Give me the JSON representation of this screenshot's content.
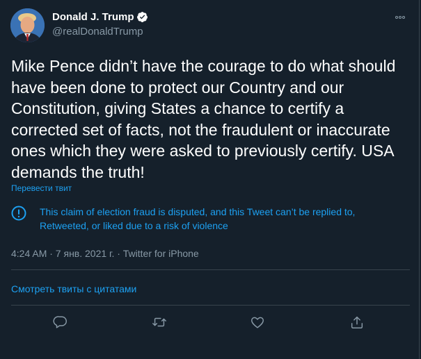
{
  "author": {
    "display_name": "Donald J. Trump",
    "handle": "@realDonaldTrump",
    "verified": true
  },
  "tweet": {
    "text": "Mike Pence didn’t have the courage to do what should have been done to protect our Country and our Constitution, giving States a chance to certify a corrected set of facts, not the fraudulent or inaccurate ones which they were asked to previously certify. USA demands the truth!",
    "translate_label": "Перевести твит",
    "notice": "This claim of election fraud is disputed, and this Tweet can’t be replied to, Retweeted, or liked due to a risk of violence",
    "meta": "4:24 AM · 7 янв. 2021 г. · Twitter for iPhone",
    "quotes_label": "Смотреть твиты с цитатами"
  },
  "icons": {
    "more": "more-icon",
    "verified": "verified-badge-icon",
    "notice": "exclamation-circle-icon",
    "reply": "reply-icon",
    "retweet": "retweet-icon",
    "like": "like-icon",
    "share": "share-icon"
  },
  "colors": {
    "background": "#15202b",
    "text": "#ffffff",
    "secondary_text": "#8899a6",
    "link": "#1da1f2",
    "divider": "#38444d"
  }
}
